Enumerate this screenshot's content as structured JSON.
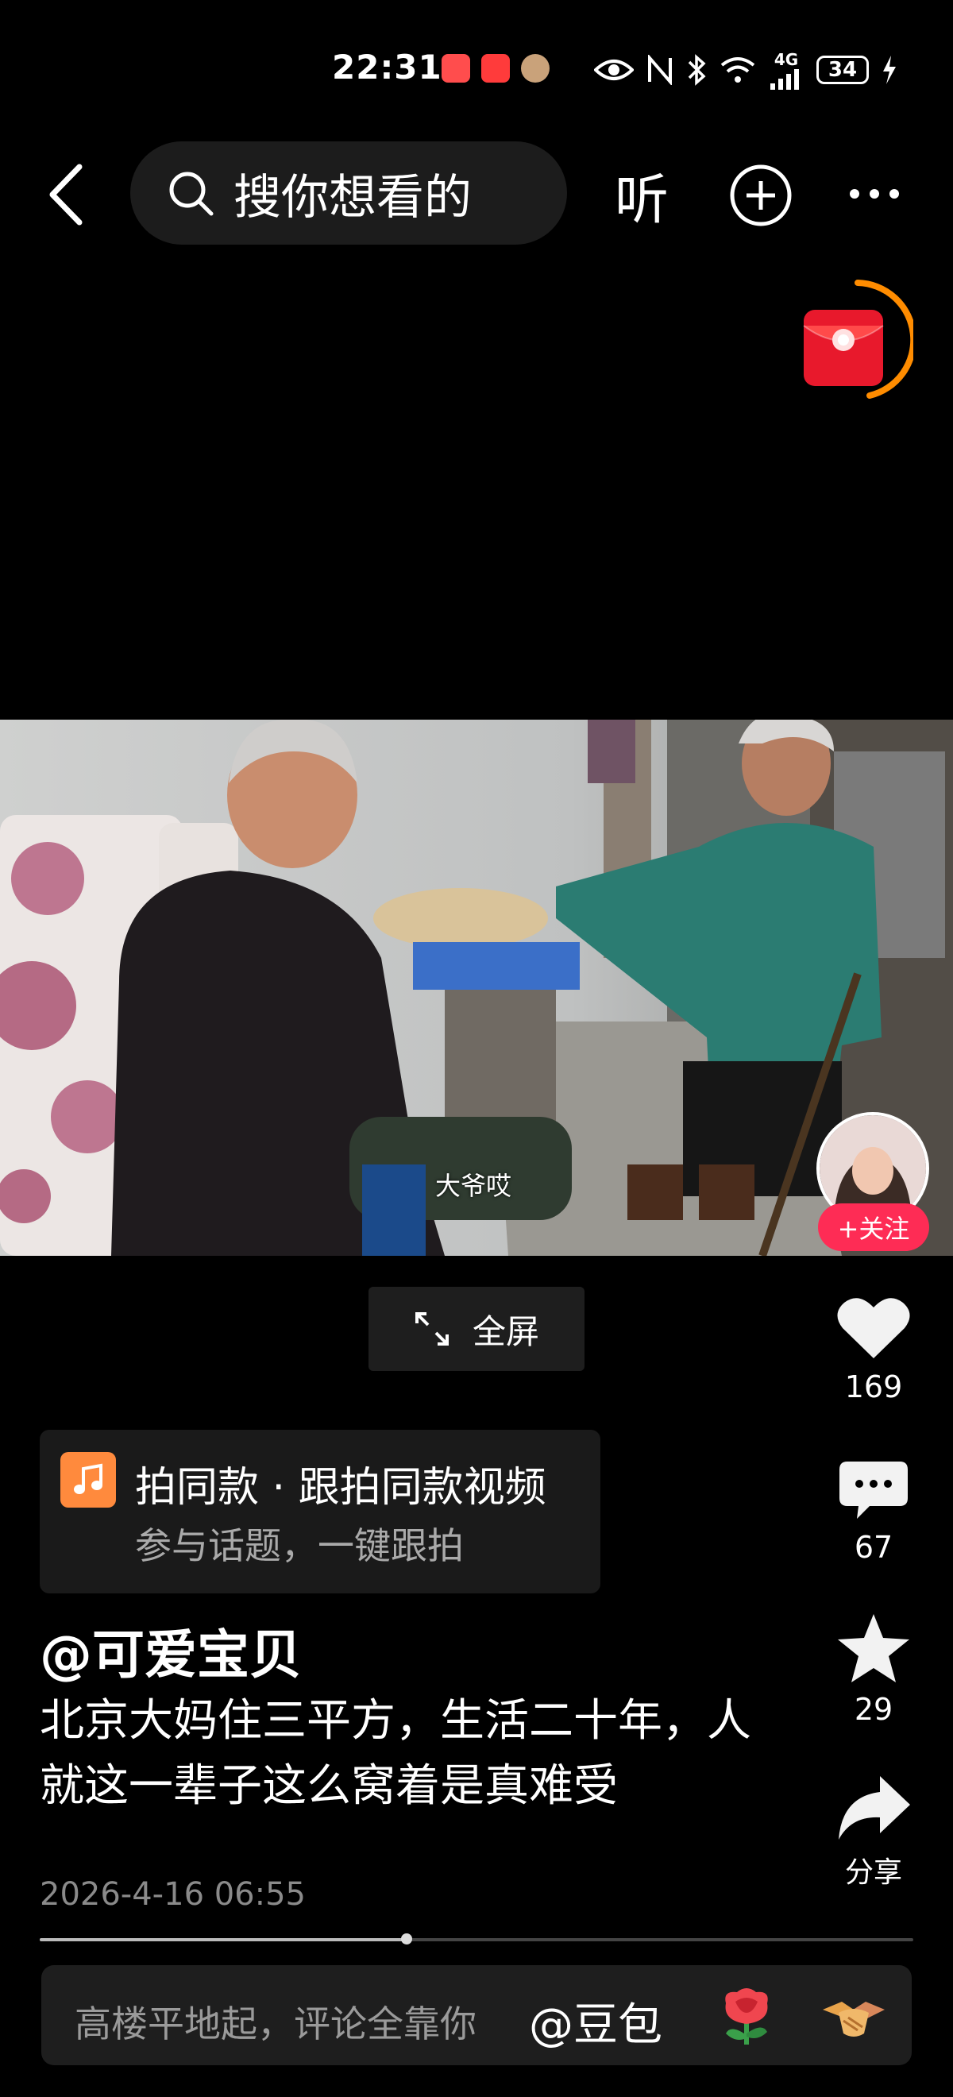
{
  "status_bar": {
    "time": "22:31",
    "network": "4G",
    "battery": "34"
  },
  "top_bar": {
    "search_placeholder": "搜你想看的",
    "listen_label": "听"
  },
  "video": {
    "subtitle": "大爷哎",
    "follow_label": "+关注"
  },
  "fullscreen_label": "全屏",
  "actions": {
    "like_count": "169",
    "comment_count": "67",
    "favorite_count": "29",
    "share_label": "分享"
  },
  "same_style": {
    "title": "拍同款 · 跟拍同款视频",
    "subtitle": "参与话题，一键跟拍"
  },
  "post": {
    "author": "@可爱宝贝",
    "description": "北京大妈住三平方，生活二十年，人就这一辈子这么窝着是真难受",
    "date": "2026-4-16 06:55"
  },
  "playback": {
    "progress_fraction": 0.42
  },
  "comment_bar": {
    "placeholder": "高楼平地起，评论全靠你",
    "mention": "@豆包"
  },
  "colors": {
    "accent": "#fe2c55",
    "music_icon": "#ff8a3d",
    "redpack": "#e8192c",
    "redpack_ring": "#ff8c00"
  }
}
